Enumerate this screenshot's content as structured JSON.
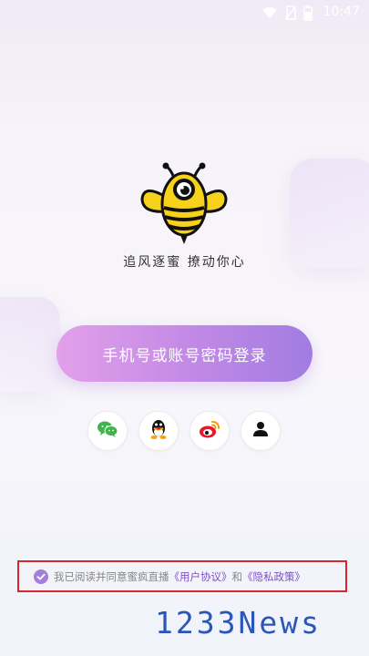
{
  "status_bar": {
    "time": "10:47",
    "icons": [
      "wifi-icon",
      "no-sim-icon",
      "battery-icon"
    ]
  },
  "logo": {
    "icon": "bee-logo-icon",
    "tagline": "追风逐蜜  撩动你心"
  },
  "login": {
    "primary_button_label": "手机号或账号密码登录"
  },
  "social_login": [
    {
      "name": "wechat",
      "icon": "wechat-icon",
      "color": "#3fb44a"
    },
    {
      "name": "qq",
      "icon": "qq-penguin-icon",
      "color": "#111111"
    },
    {
      "name": "weibo",
      "icon": "weibo-icon",
      "color": "#e6162d"
    },
    {
      "name": "account",
      "icon": "person-icon",
      "color": "#111111"
    }
  ],
  "agreement": {
    "prefix": "我已阅读并同意蜜疯直播",
    "user_agreement": "《用户协议》",
    "conjunction": "和",
    "privacy_policy": "《隐私政策》",
    "checked": true
  },
  "watermark": "1233News",
  "colors": {
    "button_gradient_start": "#e2a0ea",
    "button_gradient_end": "#a17ce2",
    "link": "#7d4fc7",
    "highlight_border": "#d7262f",
    "watermark": "#2b56b8"
  }
}
